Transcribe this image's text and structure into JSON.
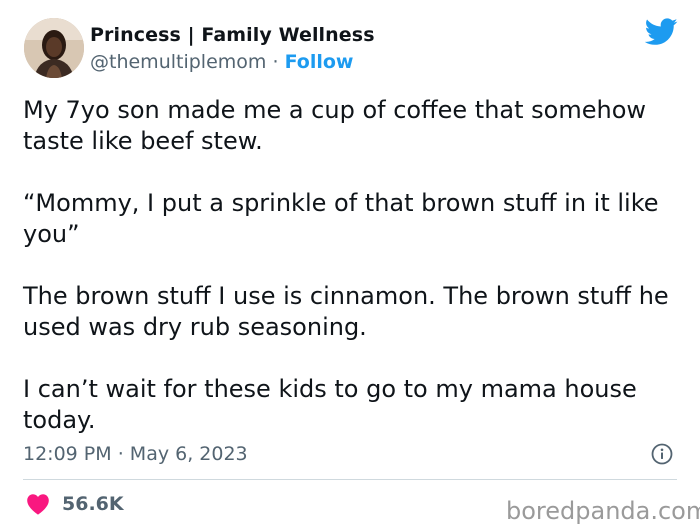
{
  "author": {
    "display_name": "Princess | Family Wellness",
    "handle": "@themultiplemom",
    "separator": "·",
    "follow_label": "Follow"
  },
  "brand_icon": "twitter-bird-icon",
  "tweet": {
    "paragraphs": [
      "My 7yo son made me a cup of coffee that somehow taste like beef stew.",
      "“Mommy, I put a sprinkle of that brown stuff in it like you”",
      "The brown stuff I use is cinnamon. The brown stuff he used was dry rub seasoning.",
      "I can’t wait for these kids to go to my mama house today."
    ]
  },
  "meta": {
    "time": "12:09 PM",
    "separator": "·",
    "date": "May 6, 2023"
  },
  "engagement": {
    "likes": "56.6K"
  },
  "watermark": "boredpanda.com",
  "colors": {
    "accent": "#1d9bf0",
    "heart": "#f91880",
    "muted": "#536471",
    "text": "#0f1419"
  }
}
